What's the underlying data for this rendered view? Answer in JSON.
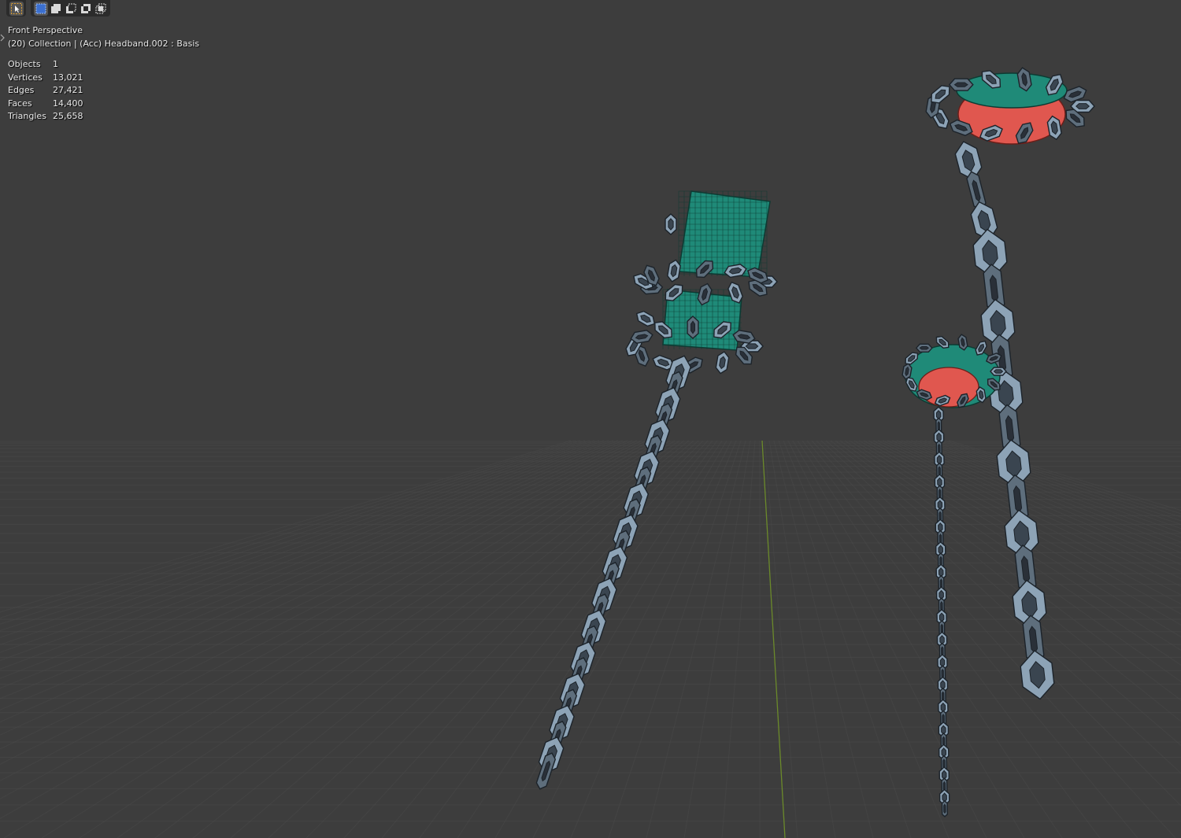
{
  "viewport": {
    "view_name": "Front Perspective",
    "context_line": "(20) Collection | (Acc) Headband.002 : Basis",
    "stats": [
      {
        "label": "Objects",
        "value": "1"
      },
      {
        "label": "Vertices",
        "value": "13,021"
      },
      {
        "label": "Edges",
        "value": "27,421"
      },
      {
        "label": "Faces",
        "value": "14,400"
      },
      {
        "label": "Triangles",
        "value": "25,658"
      }
    ]
  },
  "toolbar": {
    "tools": [
      {
        "name": "select-tool-icon",
        "active": true
      },
      {
        "name": "mode-new-icon",
        "active": true
      },
      {
        "name": "mode-extend-icon",
        "active": false
      },
      {
        "name": "mode-subtract-icon",
        "active": false
      },
      {
        "name": "mode-invert-icon",
        "active": false
      },
      {
        "name": "mode-intersect-icon",
        "active": false
      }
    ]
  },
  "colors": {
    "background": "#3d3d3d",
    "grid": "#4a4a4a",
    "y_axis": "#6b8a2a",
    "chain_fill": "#5e6e7c",
    "chain_edge": "#1c232a",
    "teal": "#1f8a78",
    "red": "#e0574f"
  }
}
